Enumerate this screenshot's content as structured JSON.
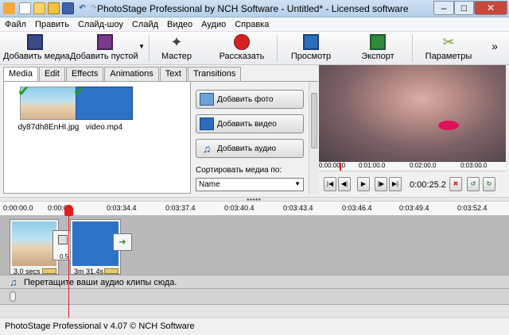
{
  "window": {
    "title": "PhotoStage Professional by NCH Software - Untitled* - Licensed software",
    "controls": {
      "minimize": "–",
      "maximize": "□",
      "close": "✕"
    }
  },
  "quick_access": [
    "new-icon",
    "open-icon",
    "export-icon",
    "save-icon",
    "undo-icon",
    "redo-icon"
  ],
  "menu": [
    "Файл",
    "Править",
    "Слайд-шоу",
    "Слайд",
    "Видео",
    "Аудио",
    "Справка"
  ],
  "toolbar": {
    "add_media": "Добавить медиа",
    "add_blank": "Добавить пустой",
    "wizard": "Мастер",
    "narrate": "Рассказать",
    "preview": "Просмотр",
    "export": "Экспорт",
    "options": "Параметры",
    "more": "»"
  },
  "tabs": [
    "Media",
    "Edit",
    "Effects",
    "Animations",
    "Text",
    "Transitions"
  ],
  "media": {
    "items": [
      {
        "name": "dy87dh8EnHI.jpg"
      },
      {
        "name": "video.mp4"
      }
    ]
  },
  "actions": {
    "add_photo": "Добавить фото",
    "add_video": "Добавить видео",
    "add_audio": "Добавить аудио",
    "sort_label": "Сортировать медиа по:",
    "sort_value": "Name"
  },
  "preview": {
    "ruler_ticks": [
      "0:00:00.0",
      "0:01:00.0",
      "0:02:00.0",
      "0:03:00.0"
    ],
    "time": "0:00:25.2"
  },
  "timeline": {
    "ticks": [
      "0:00:00.0",
      "0:00:0",
      "0:03:34.4",
      "0:03:37.4",
      "0:03:40.4",
      "0:03:43.4",
      "0:03:46.4",
      "0:03:49.4",
      "0:03:52.4"
    ],
    "clip1_duration": "3.0 secs",
    "transition_duration": "0.5",
    "clip2_duration": "3m 31.4s",
    "audio_hint": "Перетащите ваши аудио клипы сюда."
  },
  "status": "PhotoStage Professional v 4.07 © NCH Software",
  "colors": {
    "accent": "#2a6ebb",
    "playhead": "#e21b1b",
    "check": "#1c9a1c",
    "record": "#d42222"
  }
}
